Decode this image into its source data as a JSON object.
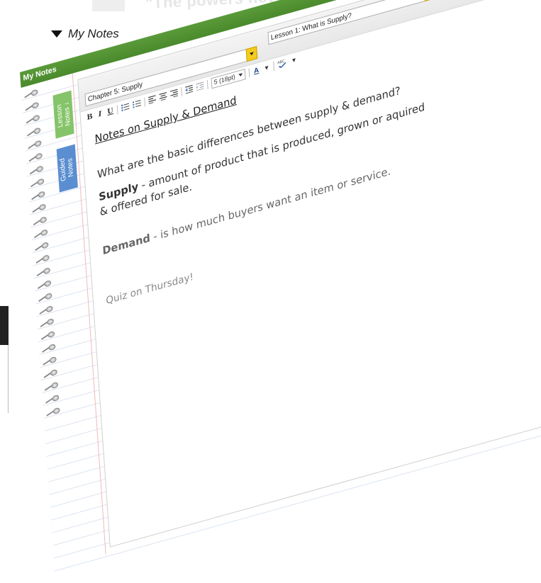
{
  "background": {
    "quote_fragment": "\"The powers not dele"
  },
  "window": {
    "close_glyph": "×"
  },
  "toggle": {
    "label": "My Notes"
  },
  "panel": {
    "title": "My Notes",
    "tabs": [
      {
        "label_line1": "Lesson",
        "label_line2": "Notes ↓",
        "color": "#86c46a"
      },
      {
        "label_line1": "Guided",
        "label_line2": "Notes",
        "color": "#5a8ed0"
      }
    ],
    "chapter_select": {
      "value": "Chapter 5: Supply"
    },
    "lesson_select": {
      "value": "Lesson 1: What is Supply?"
    },
    "toolbar": {
      "bold": "B",
      "italic": "I",
      "underline": "U",
      "font_size": "5 (18pt)",
      "text_color": "A",
      "bullet_list_icon": "bullet-list-icon",
      "numbered_list_icon": "numbered-list-icon",
      "align_left_icon": "align-left-icon",
      "align_center_icon": "align-center-icon",
      "align_right_icon": "align-right-icon",
      "outdent_icon": "outdent-icon",
      "indent_icon": "indent-icon",
      "spellcheck_icon": "spellcheck-icon"
    },
    "notes": {
      "title": "Notes on Supply & Demand",
      "question": "What are the basic differences between supply & demand?",
      "supply_term": "Supply",
      "supply_def": " - amount of product that is produced, grown or aquired",
      "supply_def_2": "& offered for sale.",
      "demand_term": "Demand",
      "demand_def": " - is how much buyers want an item or service.",
      "reminder": "Quiz on Thursday!"
    },
    "accent": "#4a8a2c"
  }
}
